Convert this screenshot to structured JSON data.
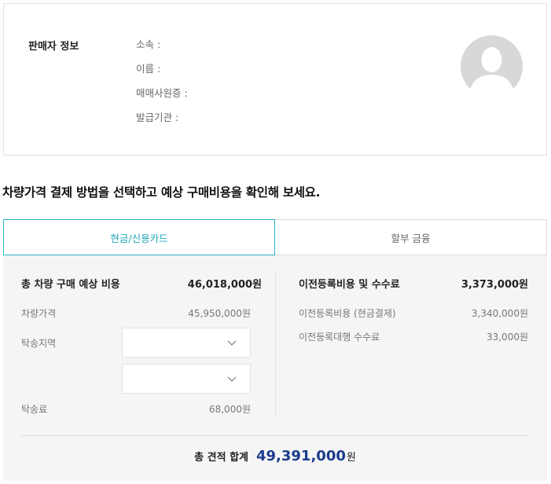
{
  "seller": {
    "title": "판매자 정보",
    "fields": [
      "소속 :",
      "이름 :",
      "매매사원증 :",
      "발급기관 :"
    ]
  },
  "heading": "차량가격 결제 방법을 선택하고 예상 구매비용을 확인해 보세요.",
  "tabs": {
    "cash": "현금/신용카드",
    "loan": "할부 금융"
  },
  "left": {
    "total_label": "총 차량 구매 예상 비용",
    "total_value": "46,018,000원",
    "price_label": "차량가격",
    "price_value": "45,950,000원",
    "region_label": "탁송지역",
    "delivery_fee_label": "탁송료",
    "delivery_fee_value": "68,000원"
  },
  "right": {
    "total_label": "이전등록비용 및 수수료",
    "total_value": "3,373,000원",
    "reg_cost_label": "이전등록비용 (현금결제)",
    "reg_cost_value": "3,340,000원",
    "agency_fee_label": "이전등록대행 수수료",
    "agency_fee_value": "33,000원"
  },
  "grand_total": {
    "label": "총 견적 합계",
    "amount": "49,391,000",
    "unit": "원"
  },
  "colors": {
    "accent": "#2bb3c8",
    "total_amount": "#1a3c8c",
    "panel_bg": "#f5f5f5",
    "avatar_bg": "#d8d8d8"
  },
  "icons": {
    "avatar": "user-silhouette-icon",
    "select_arrow": "chevron-down-icon"
  }
}
